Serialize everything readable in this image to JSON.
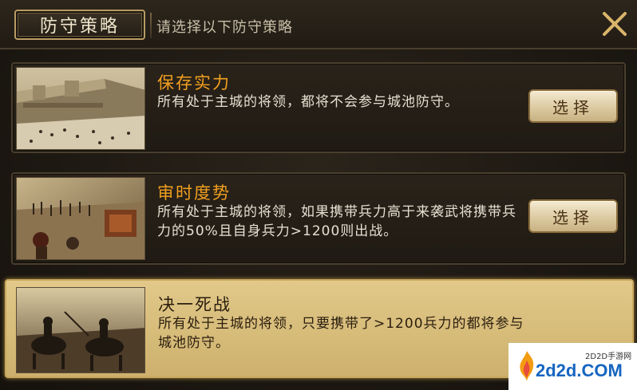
{
  "header": {
    "title": "防守策略",
    "subtitle": "请选择以下防守策略"
  },
  "strategies": [
    {
      "title": "保存实力",
      "description": "所有处于主城的将领，都将不会参与城池防守。",
      "button_label": "选择",
      "selected": false
    },
    {
      "title": "审时度势",
      "description": "所有处于主城的将领，如果携带兵力高于来袭武将携带兵力的50%且自身兵力>1200则出战。",
      "button_label": "选择",
      "selected": false
    },
    {
      "title": "决一死战",
      "description": "所有处于主城的将领，只要携带了>1200兵力的都将参与城池防守。",
      "selected": true
    }
  ],
  "watermark": {
    "small_text": "2D2D手游网",
    "big_text": "2d2d.COM"
  },
  "colors": {
    "accent_gold": "#c9a95e",
    "title_orange": "#f2a020",
    "selected_bg": "#d9be7c"
  },
  "icons": {
    "close": "close-icon"
  }
}
